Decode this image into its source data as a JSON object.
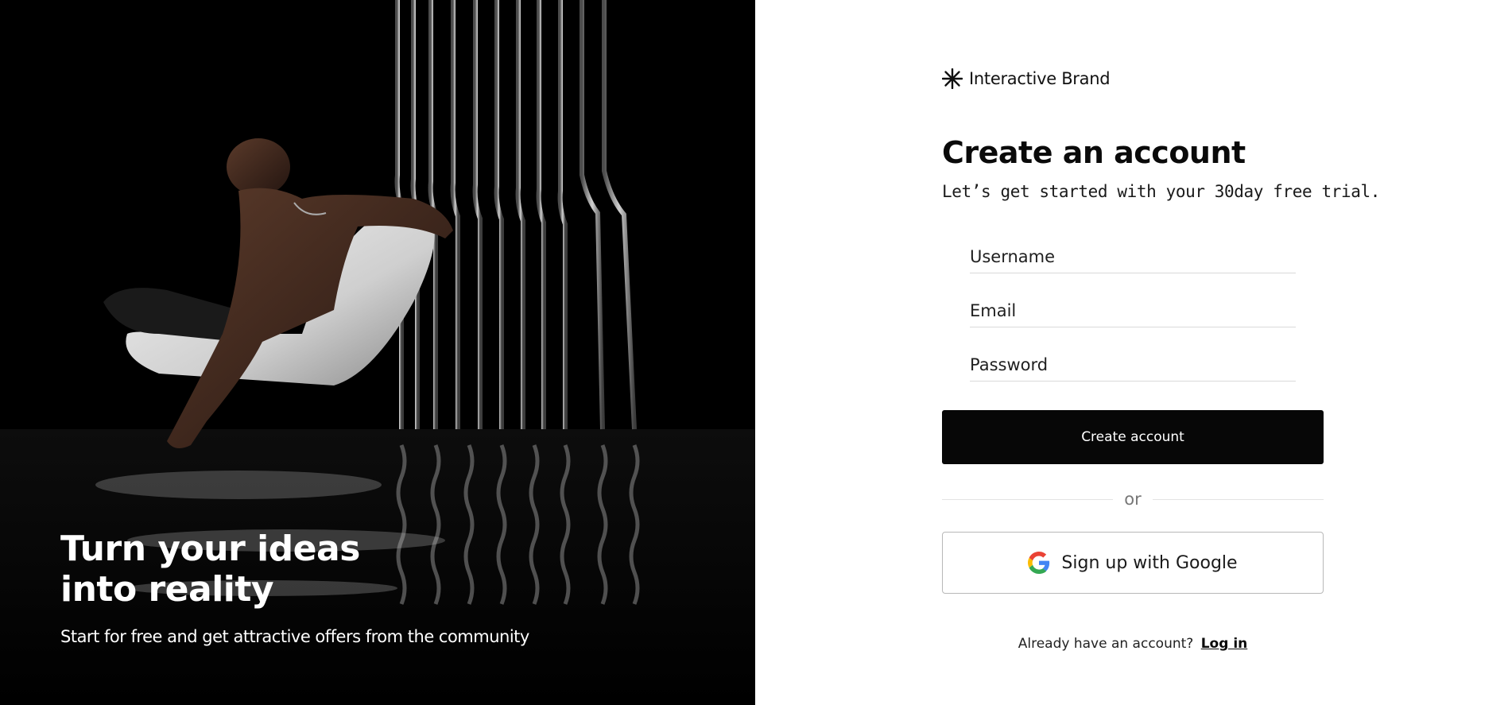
{
  "hero": {
    "title_line1": "Turn your ideas",
    "title_line2": "into reality",
    "subtitle": "Start for free and get attractive offers from the community"
  },
  "brand": {
    "name": "Interactive Brand",
    "icon": "asterisk-logo-icon"
  },
  "form": {
    "title": "Create an account",
    "subtitle": "Let’s get started with your 30day free trial.",
    "username_placeholder": "Username",
    "email_placeholder": "Email",
    "password_placeholder": "Password",
    "submit_label": "Create account",
    "divider_label": "or",
    "google_label": "Sign up with Google",
    "google_icon": "google-logo-icon",
    "login_prompt": "Already have an account?",
    "login_link": "Log in"
  },
  "colors": {
    "primary_button": "#070707",
    "hero_background": "#000000",
    "page_background": "#ffffff"
  }
}
